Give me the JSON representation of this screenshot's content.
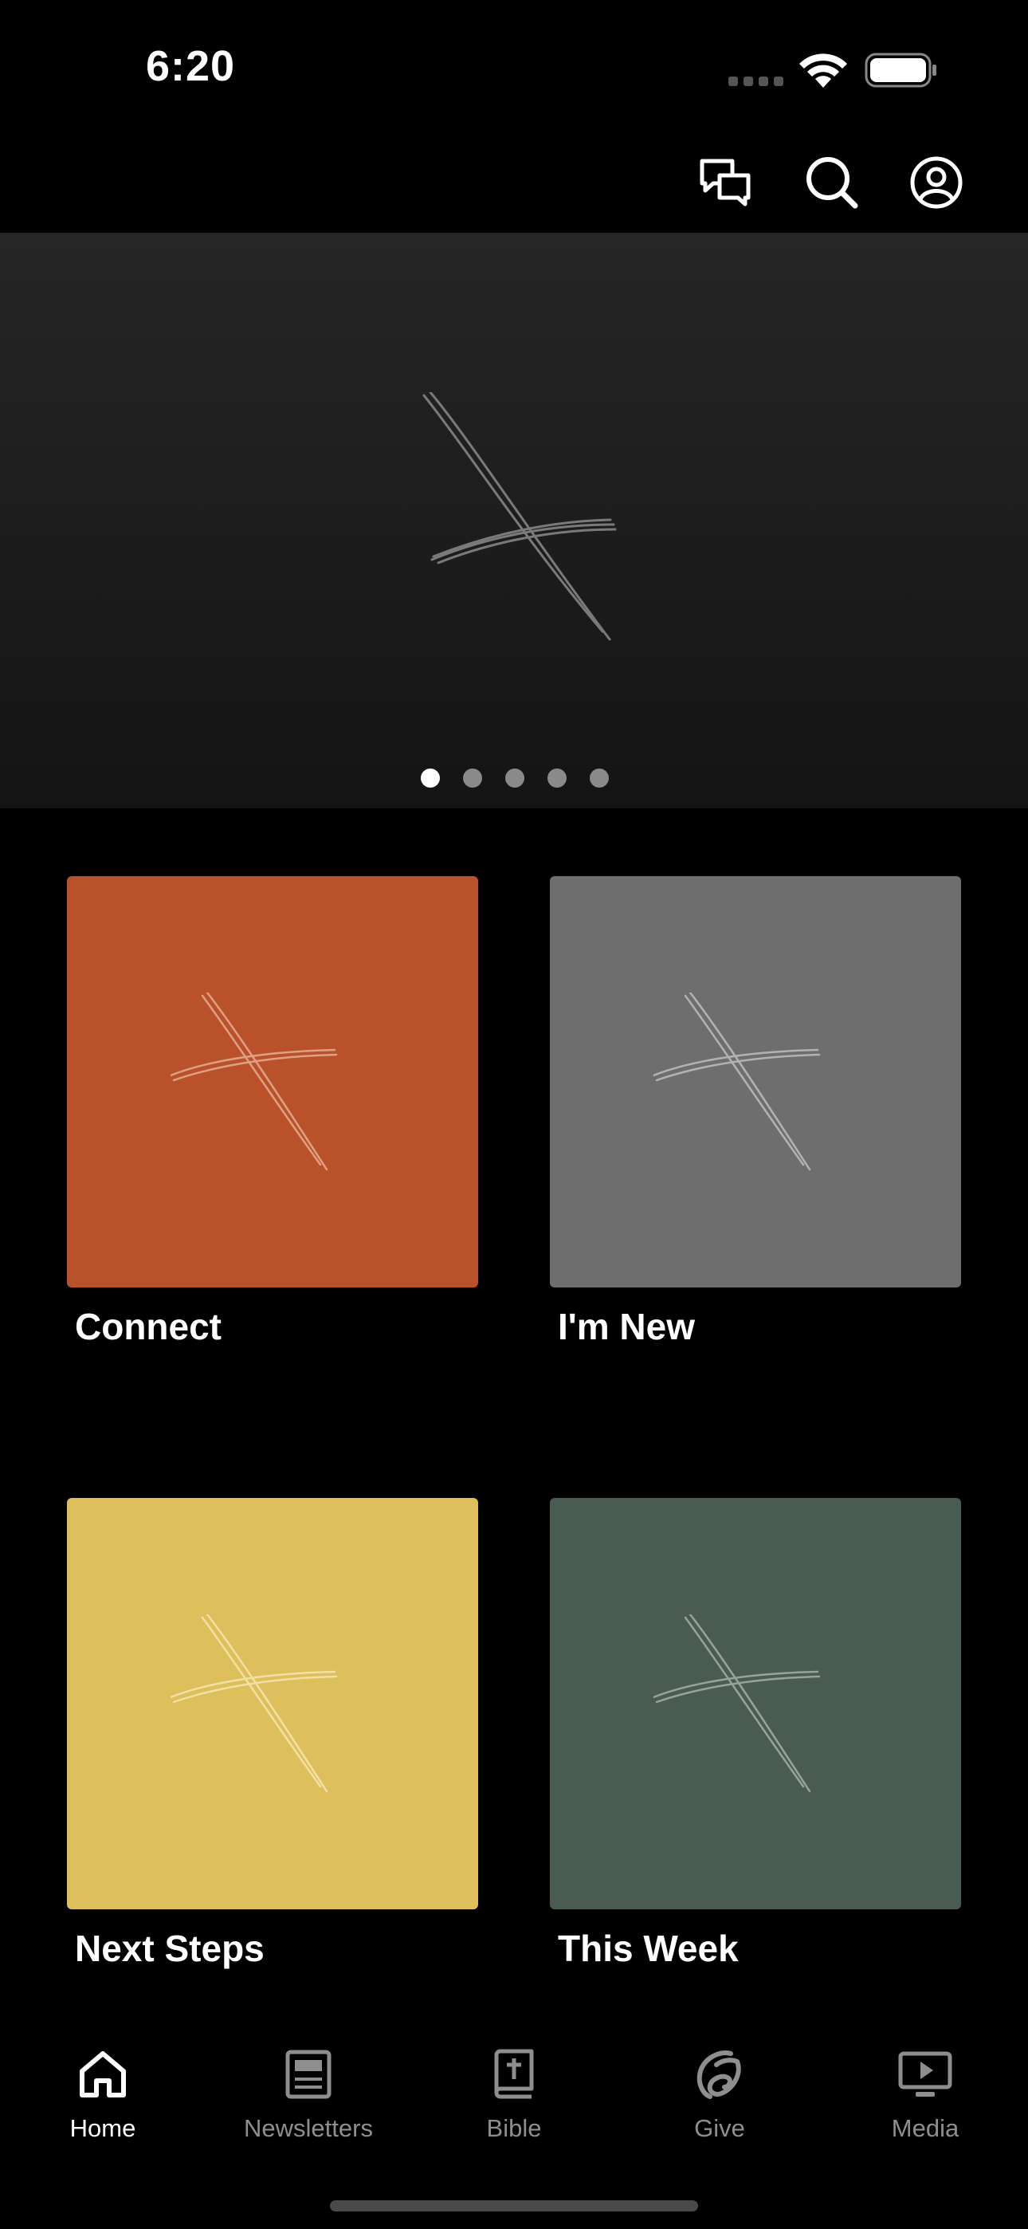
{
  "status_bar": {
    "time": "6:20"
  },
  "header": {
    "icons": [
      "chat-icon",
      "search-icon",
      "profile-icon"
    ]
  },
  "hero": {
    "slide_count": 5,
    "active_slide": 1,
    "background": "#1e1e1e"
  },
  "tiles": [
    {
      "label": "Connect",
      "color": "#b9512a"
    },
    {
      "label": "I'm New",
      "color": "#6f6e6e"
    },
    {
      "label": "Next Steps",
      "color": "#ddbf5b"
    },
    {
      "label": "This Week",
      "color": "#4a5b52"
    }
  ],
  "tabs": [
    {
      "label": "Home",
      "icon": "home-icon",
      "active": true
    },
    {
      "label": "Newsletters",
      "icon": "newsletter-icon",
      "active": false
    },
    {
      "label": "Bible",
      "icon": "bible-icon",
      "active": false
    },
    {
      "label": "Give",
      "icon": "give-icon",
      "active": false
    },
    {
      "label": "Media",
      "icon": "media-icon",
      "active": false
    }
  ],
  "colors": {
    "tab_active": "#ffffff",
    "tab_inactive": "#8e8e8e",
    "background": "#000000"
  }
}
